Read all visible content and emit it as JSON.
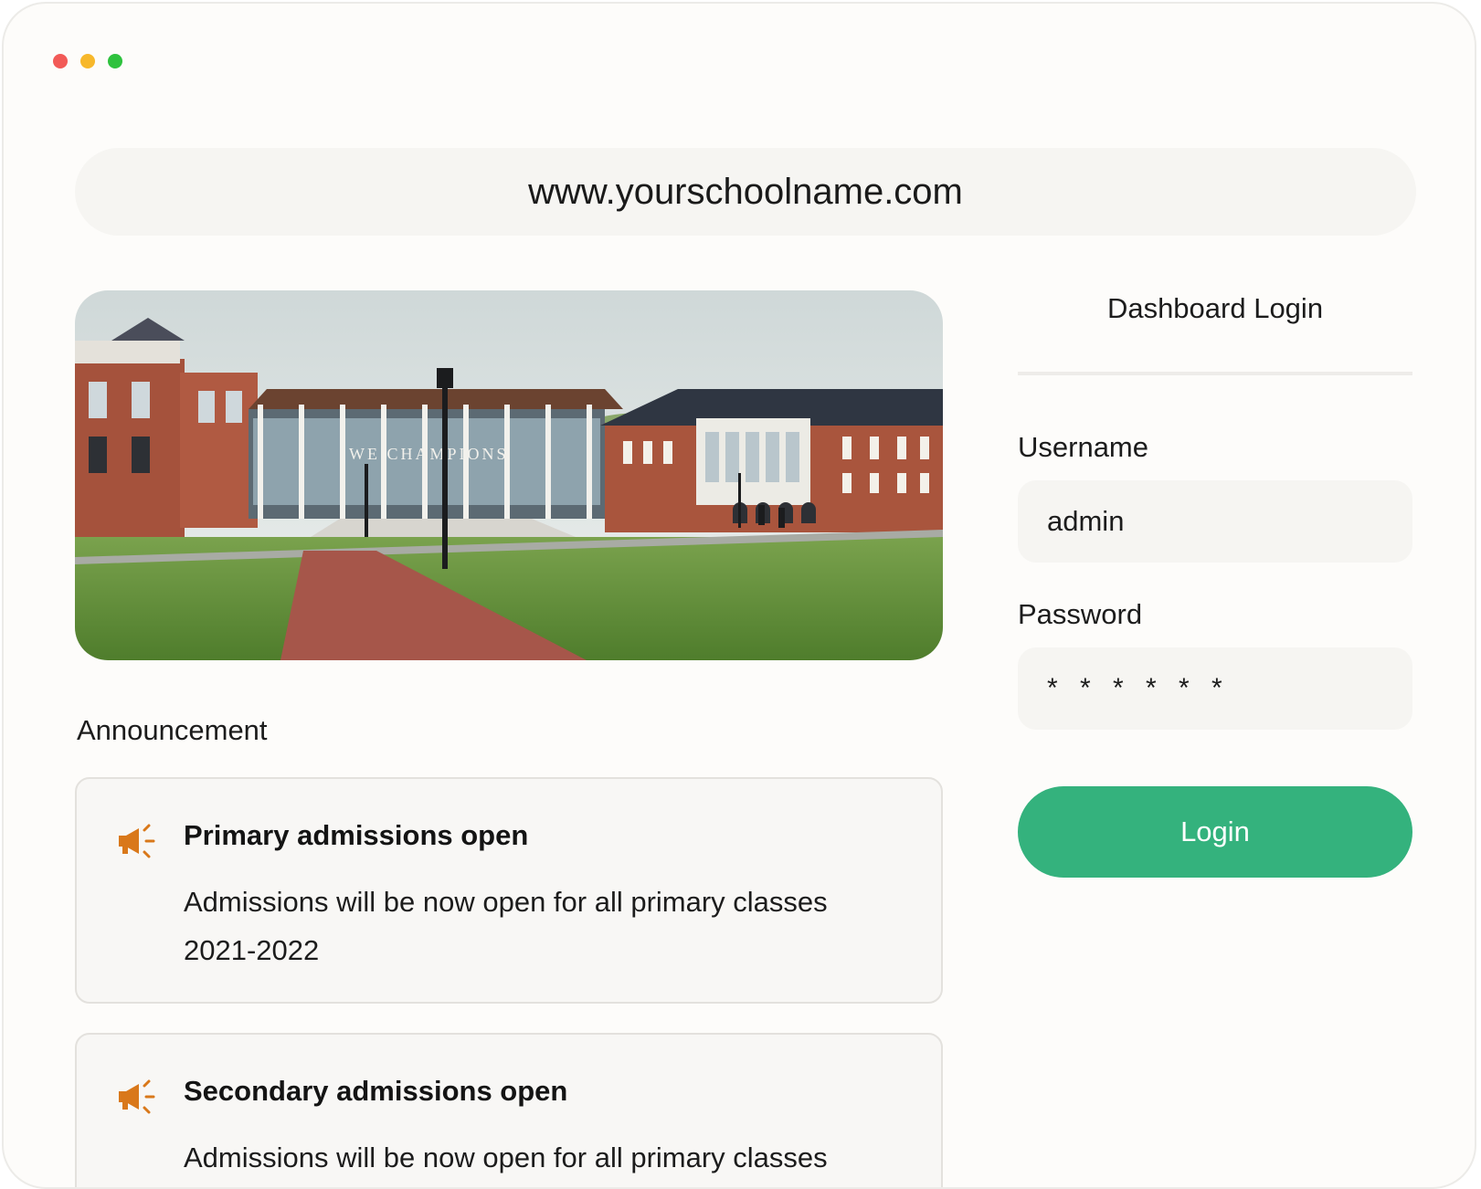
{
  "window": {
    "controls": [
      "close",
      "minimize",
      "maximize"
    ]
  },
  "address_bar": {
    "url": "www.yourschoolname.com"
  },
  "hero": {
    "building_sign": "WE CHAMPIONS",
    "colors": {
      "sky": "#dfe5e6",
      "brick": "#a5523c",
      "grass": "#5f8e3a",
      "path": "#a6564a"
    }
  },
  "announcements": {
    "heading": "Announcement",
    "icon": "megaphone-icon",
    "icon_color": "#d9781a",
    "items": [
      {
        "title": "Primary admissions open",
        "body": "Admissions will be now open for all primary classes 2021-2022"
      },
      {
        "title": "Secondary admissions open",
        "body": "Admissions will be now open for all primary classes"
      }
    ]
  },
  "login": {
    "title": "Dashboard Login",
    "username_label": "Username",
    "username_value": "admin",
    "password_label": "Password",
    "password_value": "******",
    "button_label": "Login",
    "button_color": "#34b27d"
  }
}
